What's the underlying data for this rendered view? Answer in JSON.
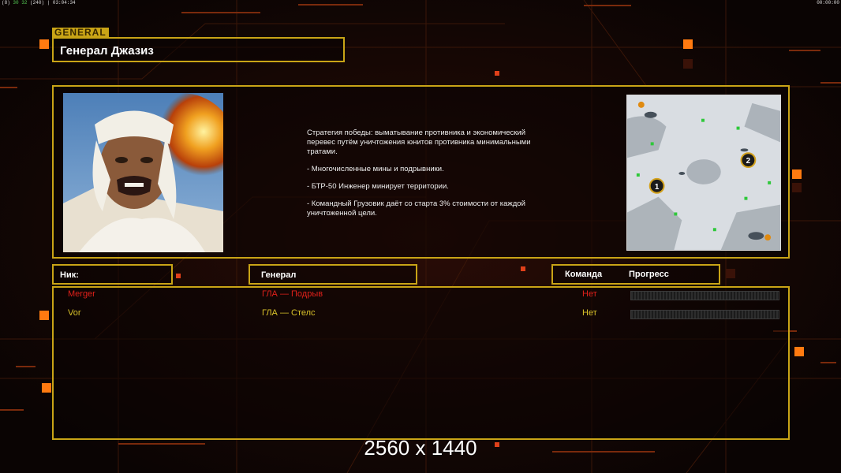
{
  "status_bar": {
    "left_prefix": "(8)",
    "left_green": "30 32",
    "left_rest": "(240) | 03:04:34",
    "right": "00:00:00"
  },
  "general_tag": "GENERAL",
  "general_name": "Генерал Джазиз",
  "description": {
    "paragraphs": [
      "Стратегия победы: выматывание противника и экономический\n перевес путём уничтожения юнитов противника минимальными\n тратами.",
      "- Многочисленные мины и подрывники.",
      "- БТР-50 Инженер минирует территории.",
      "- Командный Грузовик даёт со старта 3% стоимости от каждой\n уничтоженной цели."
    ]
  },
  "minimap": {
    "markers": [
      "1",
      "2"
    ]
  },
  "headers": {
    "nick": "Ник:",
    "general": "Генерал",
    "team": "Команда",
    "progress": "Прогресс"
  },
  "players": [
    {
      "nick": "Merger",
      "general": "ГЛА — Подрыв",
      "team": "Нет",
      "progress": 0,
      "color": "#e0201a"
    },
    {
      "nick": "Vor",
      "general": "ГЛА — Стелс",
      "team": "Нет",
      "progress": 0,
      "color": "#d8c12a"
    }
  ],
  "resolution_label": "2560 x 1440"
}
